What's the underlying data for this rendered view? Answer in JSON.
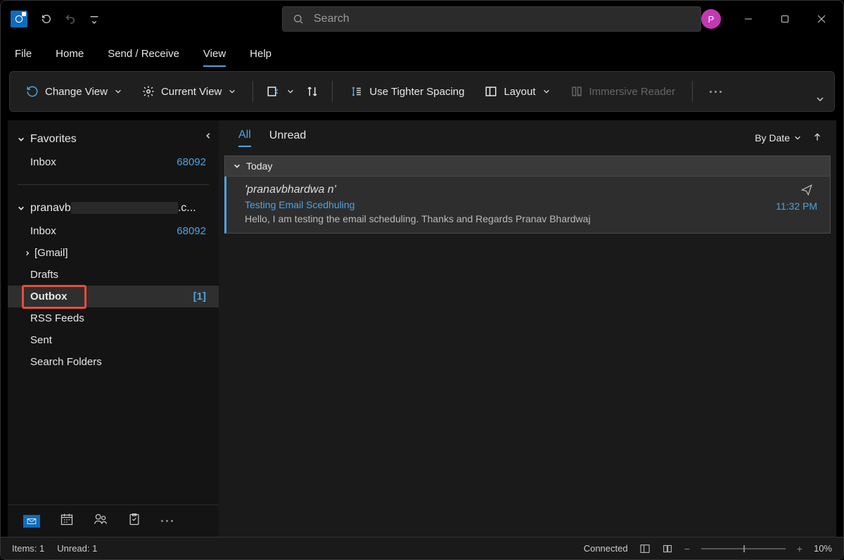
{
  "titlebar": {
    "avatar_initial": "P",
    "search_placeholder": "Search"
  },
  "menu": {
    "tabs": [
      "File",
      "Home",
      "Send / Receive",
      "View",
      "Help"
    ],
    "active_index": 3
  },
  "ribbon": {
    "change_view": "Change View",
    "current_view": "Current View",
    "tighter_spacing": "Use Tighter Spacing",
    "layout": "Layout",
    "immersive_reader": "Immersive Reader"
  },
  "sidebar": {
    "favorites_label": "Favorites",
    "favorites": [
      {
        "label": "Inbox",
        "count": "68092"
      }
    ],
    "account_label": "pranavb",
    "account_suffix": ".c...",
    "folders": [
      {
        "label": "Inbox",
        "count": "68092",
        "expandable": false
      },
      {
        "label": "[Gmail]",
        "count": "",
        "expandable": true
      },
      {
        "label": "Drafts",
        "count": "",
        "expandable": false
      },
      {
        "label": "Outbox",
        "count": "[1]",
        "expandable": false,
        "selected": true
      },
      {
        "label": "RSS Feeds",
        "count": "",
        "expandable": false
      },
      {
        "label": "Sent",
        "count": "",
        "expandable": false
      },
      {
        "label": "Search Folders",
        "count": "",
        "expandable": false
      }
    ]
  },
  "msglist": {
    "tabs": {
      "all": "All",
      "unread": "Unread"
    },
    "sort_label": "By Date",
    "group_label": "Today",
    "items": [
      {
        "from": "'pranavbhardwa                         n'",
        "subject": "Testing Email Scedhuling",
        "preview": "Hello, I am testing the email scheduling.  Thanks and Regards  Pranav Bhardwaj",
        "time": "11:32 PM"
      }
    ]
  },
  "statusbar": {
    "items": "Items: 1",
    "unread": "Unread: 1",
    "connected": "Connected",
    "zoom": "10%"
  }
}
